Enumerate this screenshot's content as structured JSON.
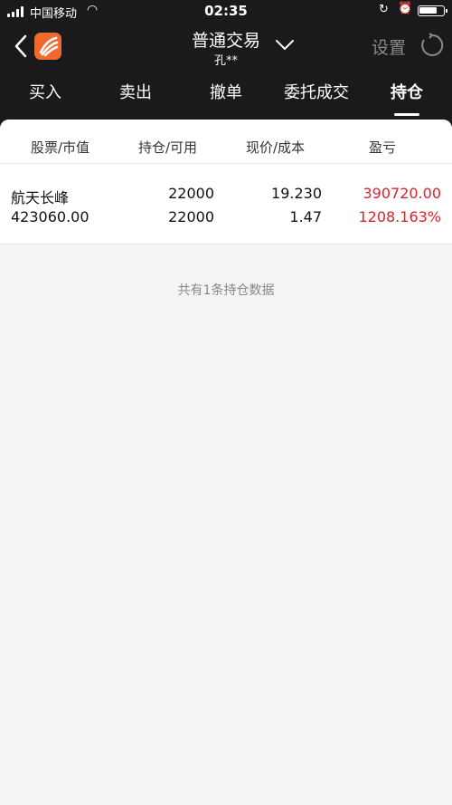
{
  "status_bar": {
    "carrier": "中国移动",
    "wifi_icon": "wifi-icon",
    "time": "02:35"
  },
  "nav": {
    "title": "普通交易",
    "subtitle": "孔**",
    "settings_label": "设置"
  },
  "tabs": [
    {
      "label": "买入"
    },
    {
      "label": "卖出"
    },
    {
      "label": "撤单"
    },
    {
      "label": "委托成交"
    },
    {
      "label": "持仓",
      "active": true
    }
  ],
  "table": {
    "headers": [
      "股票/市值",
      "持仓/可用",
      "现价/成本",
      "盈亏"
    ],
    "rows": [
      {
        "name": "航天长峰",
        "market_value": "423060.00",
        "position": "22000",
        "available": "22000",
        "price": "19.230",
        "cost": "1.47",
        "profit": "390720.00",
        "profit_pct": "1208.163%"
      }
    ]
  },
  "summary": "共有1条持仓数据",
  "colors": {
    "header_bg": "#1a1a1c",
    "logo": "#ef6a2c",
    "profit": "#d8242b"
  }
}
